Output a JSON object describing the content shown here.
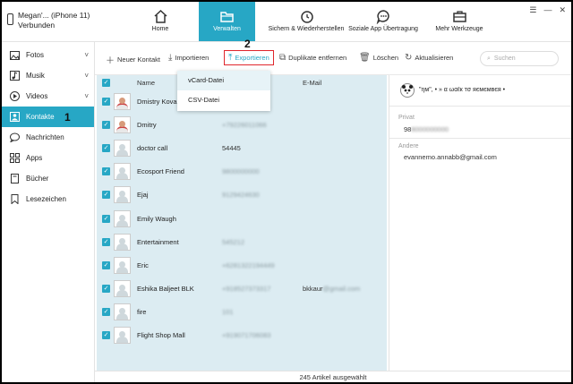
{
  "device": {
    "name": "Megan'... (iPhone 11)",
    "status": "Verbunden"
  },
  "nav": [
    {
      "label": "Home",
      "icon": "home-icon"
    },
    {
      "label": "Verwalten",
      "icon": "folder-icon"
    },
    {
      "label": "Sichern & Wiederherstellen",
      "icon": "restore-icon"
    },
    {
      "label": "Soziale App Übertragung",
      "icon": "chat-icon"
    },
    {
      "label": "Mehr Werkzeuge",
      "icon": "toolbox-icon"
    }
  ],
  "window_controls": {
    "menu": "☰",
    "minimize": "—",
    "close": "✕"
  },
  "sidebar": [
    {
      "label": "Fotos",
      "icon": "image-icon",
      "chevron": "˅"
    },
    {
      "label": "Musik",
      "icon": "music-icon",
      "chevron": "˅"
    },
    {
      "label": "Videos",
      "icon": "video-icon",
      "chevron": "˅"
    },
    {
      "label": "Kontakte",
      "icon": "contact-icon",
      "chevron": ""
    },
    {
      "label": "Nachrichten",
      "icon": "message-icon",
      "chevron": ""
    },
    {
      "label": "Apps",
      "icon": "apps-icon",
      "chevron": ""
    },
    {
      "label": "Bücher",
      "icon": "book-icon",
      "chevron": ""
    },
    {
      "label": "Lesezeichen",
      "icon": "bookmark-icon",
      "chevron": ""
    }
  ],
  "annotations": {
    "step1": "1",
    "step2": "2"
  },
  "toolbar": {
    "new_contact": "Neuer Kontakt",
    "import": "Importieren",
    "export": "Exportieren",
    "dedupe": "Duplikate entfernen",
    "delete": "Löschen",
    "refresh": "Aktualisieren",
    "search_placeholder": "Suchen"
  },
  "export_menu": [
    "vCard-Datei",
    "CSV-Datei"
  ],
  "list": {
    "columns": {
      "name": "Name",
      "email": "E-Mail"
    },
    "rows": [
      {
        "name": "Dmistry Koval",
        "phone": "",
        "email": "",
        "photo": true
      },
      {
        "name": "Dmitry",
        "phone": "+79226011066",
        "email": "",
        "photo": true
      },
      {
        "name": "doctor call",
        "phone": "54445",
        "email": "",
        "photo": false
      },
      {
        "name": "Ecosport Friend",
        "phone": "9800000000",
        "email": "",
        "photo": false
      },
      {
        "name": "Ejaj",
        "phone": "9129424630",
        "email": "",
        "photo": false
      },
      {
        "name": "Emily Waugh",
        "phone": "",
        "email": "",
        "photo": false
      },
      {
        "name": "Entertainment",
        "phone": "545212",
        "email": "",
        "photo": false
      },
      {
        "name": "Eric",
        "phone": "+6281322194449",
        "email": "",
        "photo": false
      },
      {
        "name": "Eshika Baljeet BLK",
        "phone": "+918527373317",
        "email": "bkkaur",
        "email_blur": "@gmail.com",
        "photo": false
      },
      {
        "name": "fire",
        "phone": "101",
        "email": "",
        "photo": false
      },
      {
        "name": "Flight Shop Mall",
        "phone": "+919071706083",
        "email": "",
        "photo": false
      }
    ]
  },
  "detail": {
    "name": "\"ηм\", • » α ωαℓк тσ яємємвєя •",
    "privat_label": "Privat",
    "privat_value": "98",
    "privat_blur": "8000000000",
    "andere_label": "Andere",
    "andere_value": "evannemo.annabb@gmail.com"
  },
  "status": "245 Artikel ausgewählt",
  "colors": {
    "accent": "#27a7c5",
    "highlight": "#e0262c",
    "list_bg": "#dcecf2"
  }
}
